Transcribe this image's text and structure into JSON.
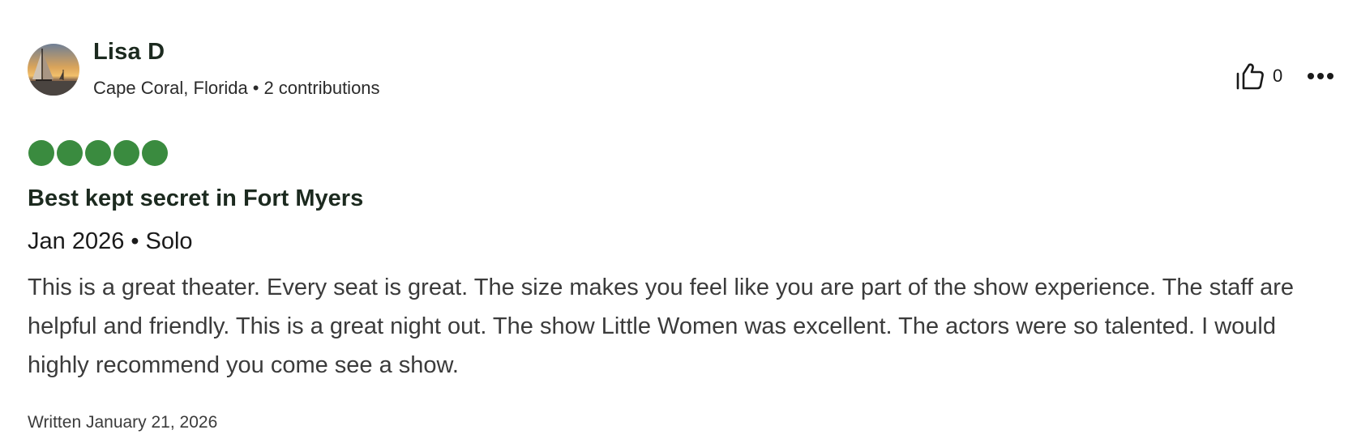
{
  "reviewer": {
    "name": "Lisa D",
    "location": "Cape Coral, Florida",
    "separator": "•",
    "contributions": "2 contributions",
    "avatar_icon": "sailboat-sunset-avatar"
  },
  "actions": {
    "helpful_icon": "thumbs-up-icon",
    "helpful_count": "0",
    "more_icon": "more-options-icon"
  },
  "rating": {
    "value": 5,
    "max": 5,
    "color": "#3a8b3f"
  },
  "review": {
    "title": "Best kept secret in Fort Myers",
    "date": "Jan 2026",
    "separator": "•",
    "trip_type": "Solo",
    "body": "This is a great theater. Every seat is great. The size makes you feel like you are part of the show experience. The staff are helpful and friendly. This is a great night out. The show Little Women was excellent. The actors were so talented. I would highly recommend you come see a show.",
    "written": "Written January 21, 2026"
  }
}
